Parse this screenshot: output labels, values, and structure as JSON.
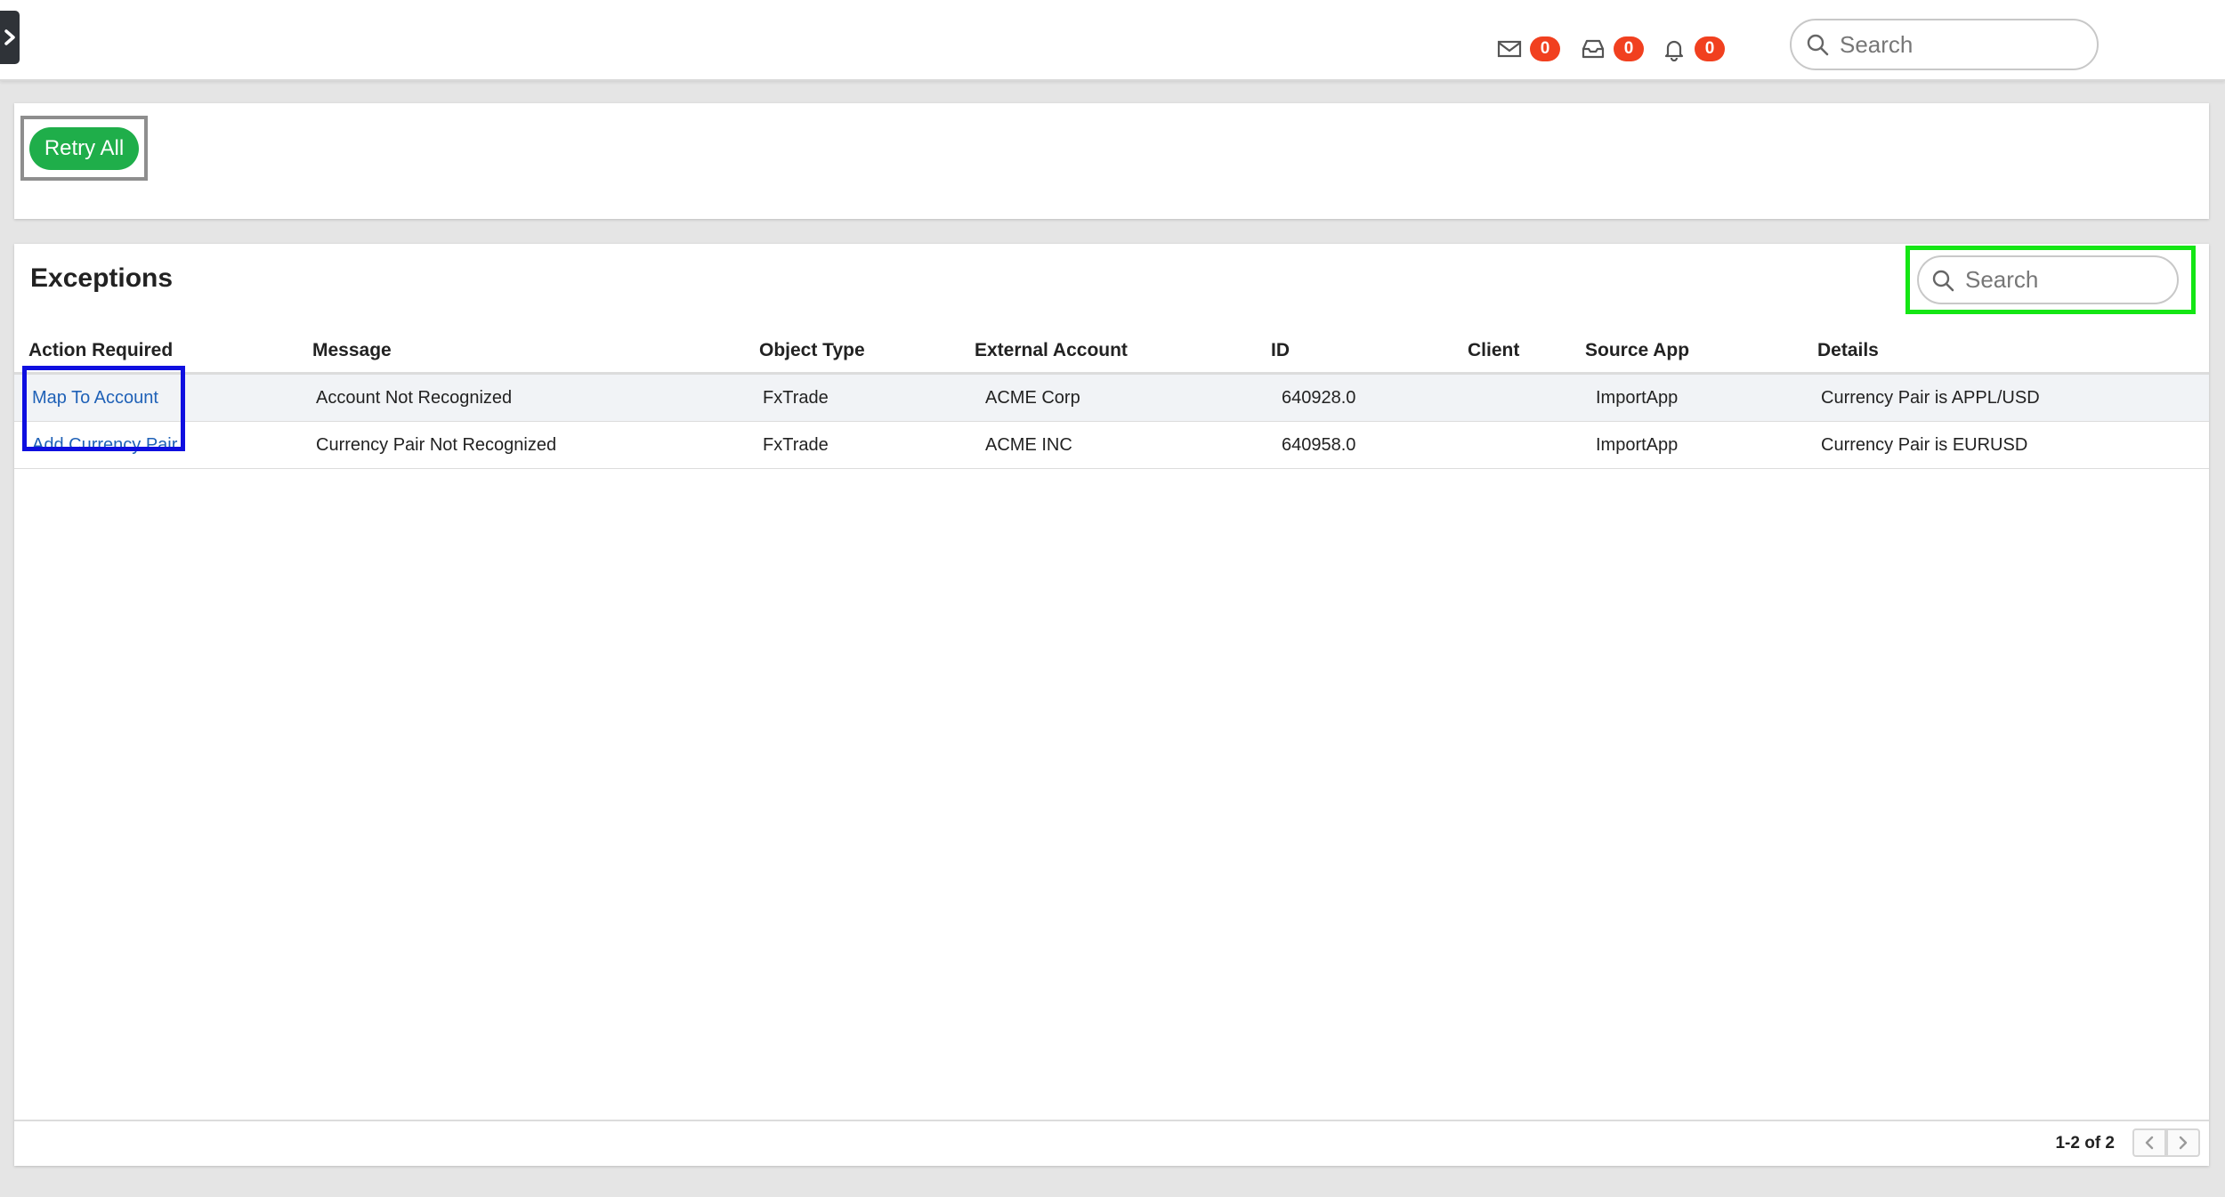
{
  "header": {
    "notifications": [
      {
        "icon": "mail-icon",
        "count": "0"
      },
      {
        "icon": "inbox-icon",
        "count": "0"
      },
      {
        "icon": "bell-icon",
        "count": "0"
      }
    ],
    "search": {
      "placeholder": "Search"
    }
  },
  "actions": {
    "retry_all_label": "Retry All"
  },
  "exceptions": {
    "title": "Exceptions",
    "search": {
      "placeholder": "Search"
    },
    "columns": [
      "Action Required",
      "Message",
      "Object Type",
      "External Account",
      "ID",
      "Client",
      "Source App",
      "Details"
    ],
    "rows": [
      {
        "action": "Map To Account",
        "message": "Account Not Recognized",
        "object_type": "FxTrade",
        "external_account": "ACME Corp",
        "id": "640928.0",
        "client": "",
        "source_app": "ImportApp",
        "details": "Currency Pair is APPL/USD"
      },
      {
        "action": "Add Currency Pair",
        "message": "Currency Pair Not Recognized",
        "object_type": "FxTrade",
        "external_account": "ACME INC",
        "id": "640958.0",
        "client": "",
        "source_app": "ImportApp",
        "details": "Currency Pair is EURUSD"
      }
    ],
    "pagination": {
      "summary": "1-2 of 2"
    }
  },
  "colors": {
    "badge": "#f1401f",
    "retry_button": "#1fae4a",
    "link": "#1f61b7",
    "highlight_gray": "#8e8e8e",
    "highlight_green": "#14e614",
    "highlight_blue": "#0f0fe0"
  }
}
